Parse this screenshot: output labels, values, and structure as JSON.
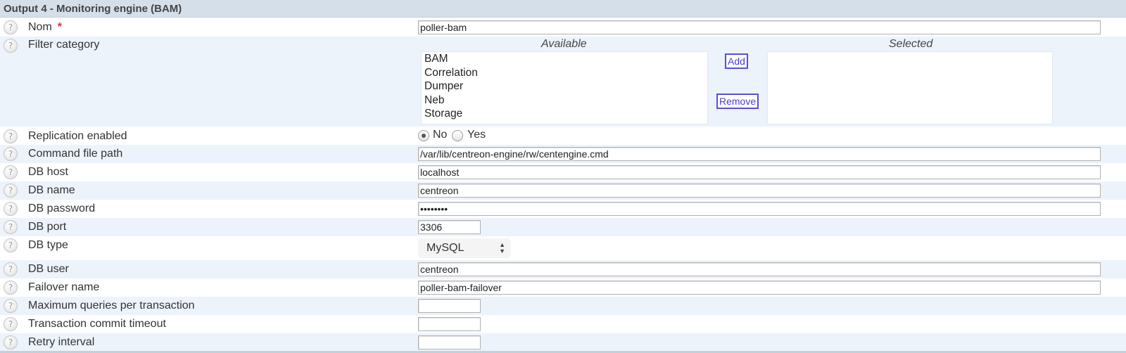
{
  "section": {
    "title": "Output 4 - Monitoring engine (BAM)"
  },
  "icons": {
    "help": "help-question-icon"
  },
  "help_glyph": "?",
  "fields": {
    "nom": {
      "label": "Nom",
      "required_mark": "*",
      "value": "poller-bam"
    },
    "filter_category": {
      "label": "Filter category",
      "available_caption": "Available",
      "selected_caption": "Selected",
      "available": [
        "BAM",
        "Correlation",
        "Dumper",
        "Neb",
        "Storage"
      ],
      "selected": [],
      "add_label": "Add",
      "remove_label": "Remove"
    },
    "replication": {
      "label": "Replication enabled",
      "options": [
        "No",
        "Yes"
      ],
      "selected": "No"
    },
    "command_file_path": {
      "label": "Command file path",
      "value": "/var/lib/centreon-engine/rw/centengine.cmd"
    },
    "db_host": {
      "label": "DB host",
      "value": "localhost"
    },
    "db_name": {
      "label": "DB name",
      "value": "centreon"
    },
    "db_password": {
      "label": "DB password",
      "value": "••••••••"
    },
    "db_port": {
      "label": "DB port",
      "value": "3306"
    },
    "db_type": {
      "label": "DB type",
      "value": "MySQL"
    },
    "db_user": {
      "label": "DB user",
      "value": "centreon"
    },
    "failover_name": {
      "label": "Failover name",
      "value": "poller-bam-failover"
    },
    "max_queries": {
      "label": "Maximum queries per transaction",
      "value": ""
    },
    "commit_timeout": {
      "label": "Transaction commit timeout",
      "value": ""
    },
    "retry_interval": {
      "label": "Retry interval",
      "value": ""
    }
  }
}
